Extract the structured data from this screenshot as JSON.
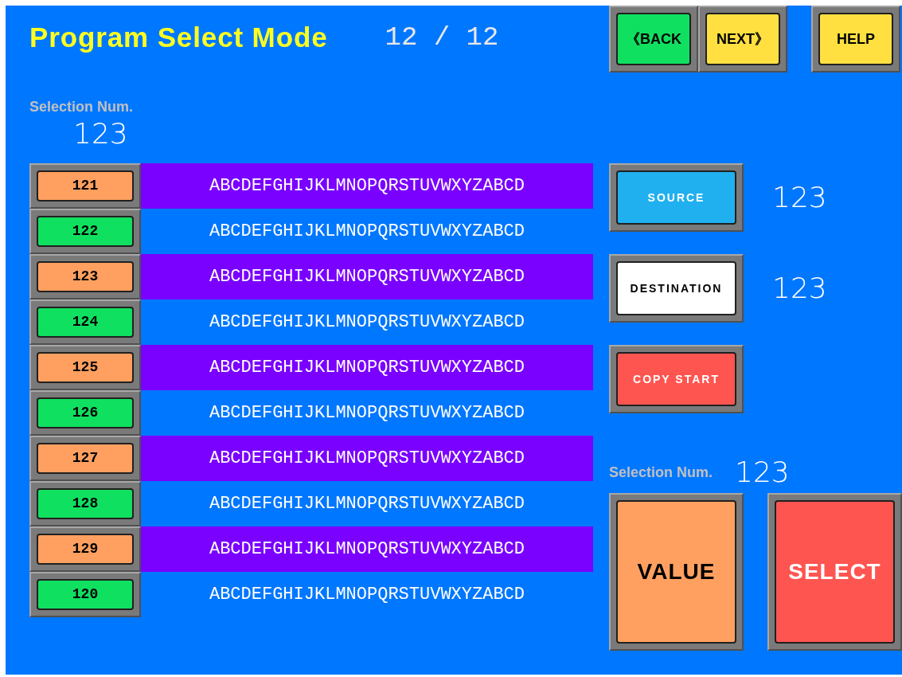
{
  "header": {
    "title": "Program Select Mode",
    "page": "12 / 12"
  },
  "nav_buttons": [
    {
      "label": "《BACK",
      "color": "#10e060"
    },
    {
      "label": "NEXT》",
      "color": "#ffe040"
    },
    {
      "label": "HELP",
      "color": "#ffe040"
    }
  ],
  "selection": {
    "label": "Selection Num.",
    "value": "123"
  },
  "rows": [
    {
      "number": "121",
      "text": "ABCDEFGHIJKLMNOPQRSTUVWXYZABCD",
      "highlighted": true
    },
    {
      "number": "122",
      "text": "ABCDEFGHIJKLMNOPQRSTUVWXYZABCD",
      "highlighted": false
    },
    {
      "number": "123",
      "text": "ABCDEFGHIJKLMNOPQRSTUVWXYZABCD",
      "highlighted": true
    },
    {
      "number": "124",
      "text": "ABCDEFGHIJKLMNOPQRSTUVWXYZABCD",
      "highlighted": false
    },
    {
      "number": "125",
      "text": "ABCDEFGHIJKLMNOPQRSTUVWXYZABCD",
      "highlighted": true
    },
    {
      "number": "126",
      "text": "ABCDEFGHIJKLMNOPQRSTUVWXYZABCD",
      "highlighted": false
    },
    {
      "number": "127",
      "text": "ABCDEFGHIJKLMNOPQRSTUVWXYZABCD",
      "highlighted": true
    },
    {
      "number": "128",
      "text": "ABCDEFGHIJKLMNOPQRSTUVWXYZABCD",
      "highlighted": false
    },
    {
      "number": "129",
      "text": "ABCDEFGHIJKLMNOPQRSTUVWXYZABCD",
      "highlighted": true
    },
    {
      "number": "120",
      "text": "ABCDEFGHIJKLMNOPQRSTUVWXYZABCD",
      "highlighted": false
    }
  ],
  "copy_panel": [
    {
      "label": "SOURCE",
      "color": "#20b0f0",
      "value": "123"
    },
    {
      "label": "DESTINATION",
      "color": "#ffffff",
      "value": "123"
    },
    {
      "label": "COPY START",
      "color": "#ff5550"
    }
  ],
  "selection_right": {
    "label": "Selection Num.",
    "value": "123"
  },
  "action_buttons": [
    {
      "label": "VALUE",
      "color": "#ffa060"
    },
    {
      "label": "SELECT",
      "color": "#ff5550"
    }
  ]
}
